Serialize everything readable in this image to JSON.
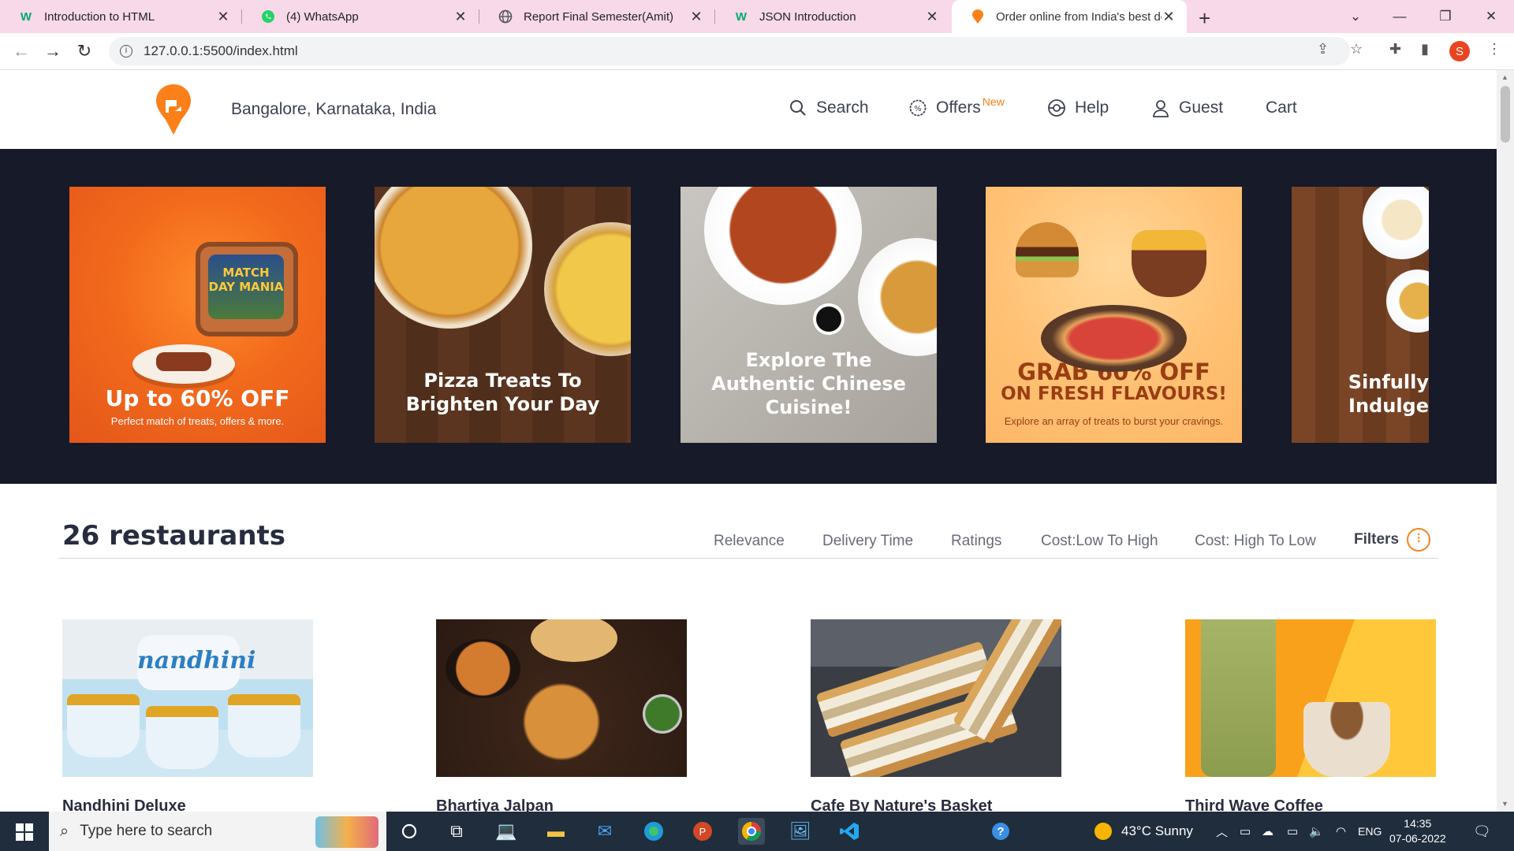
{
  "browser": {
    "tabs": [
      {
        "title": "Introduction to HTML",
        "icon": "w3schools-favicon"
      },
      {
        "title": "(4) WhatsApp",
        "icon": "whatsapp-favicon"
      },
      {
        "title": "Report Final Semester(Amit)",
        "icon": "globe-favicon"
      },
      {
        "title": "JSON Introduction",
        "icon": "w3schools-favicon"
      },
      {
        "title": "Order online from India's best de",
        "icon": "swiggy-favicon",
        "active": true
      }
    ],
    "url": "127.0.0.1:5500/index.html",
    "profile_initial": "S"
  },
  "header": {
    "location": "Bangalore, Karnataka, India",
    "nav": {
      "search": "Search",
      "offers": "Offers",
      "offers_badge": "New",
      "help": "Help",
      "guest": "Guest",
      "cart": "Cart"
    }
  },
  "offers": [
    {
      "title": "Up to 60% OFF",
      "subtitle": "Perfect match of treats, offers & more.",
      "tv_text": "MATCH DAY MANIA"
    },
    {
      "title": "Pizza Treats To Brighten Your Day"
    },
    {
      "title": "Explore The Authentic Chinese Cuisine!"
    },
    {
      "title": "GRAB 60% OFF",
      "title2": "ON FRESH FLAVOURS!",
      "subtitle": "Explore an array of treats to burst your cravings."
    },
    {
      "title": "Sinfully Indulge"
    }
  ],
  "restaurants": {
    "count_label": "26 restaurants",
    "sort_options": [
      "Relevance",
      "Delivery Time",
      "Ratings",
      "Cost:Low To High",
      "Cost: High To Low"
    ],
    "filters_label": "Filters",
    "items": [
      {
        "name": "Nandhini Deluxe",
        "image_text": "nandhini"
      },
      {
        "name": "Bhartiya Jalpan"
      },
      {
        "name": "Cafe By Nature's Basket"
      },
      {
        "name": "Third Wave Coffee"
      }
    ]
  },
  "taskbar": {
    "search_placeholder": "Type here to search",
    "weather": "43°C  Sunny",
    "language": "ENG",
    "time": "14:35",
    "date": "07-06-2022"
  },
  "colors": {
    "brand": "#fc8019",
    "band": "#171a29",
    "tabstrip": "#f7d9ea",
    "taskbar": "#1f2d3d"
  }
}
